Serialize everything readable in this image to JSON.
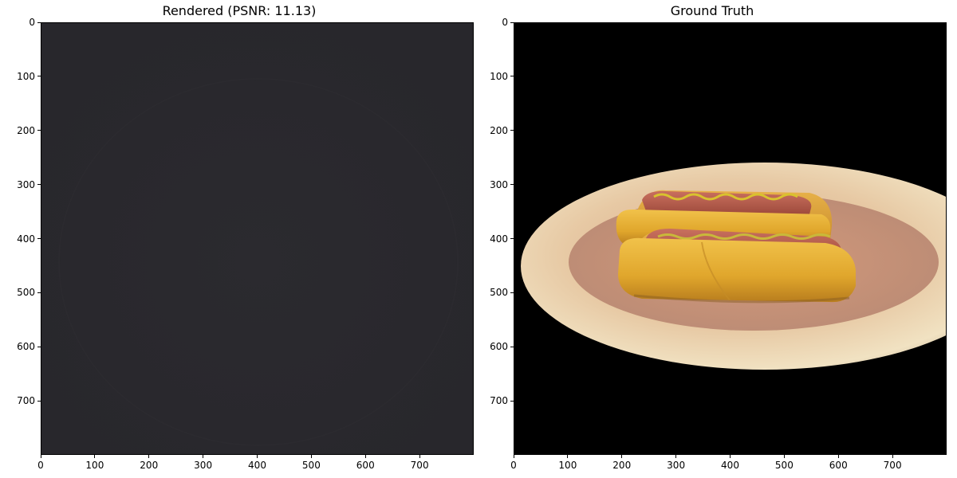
{
  "panels": [
    {
      "title": "Rendered (PSNR: 11.13)",
      "image": "dark-gray-render",
      "x_ticks": [
        "0",
        "100",
        "200",
        "300",
        "400",
        "500",
        "600",
        "700"
      ],
      "y_ticks": [
        "0",
        "100",
        "200",
        "300",
        "400",
        "500",
        "600",
        "700"
      ]
    },
    {
      "title": "Ground Truth",
      "image": "hotdogs-on-plate",
      "x_ticks": [
        "0",
        "100",
        "200",
        "300",
        "400",
        "500",
        "600",
        "700"
      ],
      "y_ticks": [
        "0",
        "100",
        "200",
        "300",
        "400",
        "500",
        "600",
        "700"
      ]
    }
  ],
  "colors": {
    "render_bg": "#2a292e",
    "truth_bg": "#000000",
    "bun": "#e0a62c",
    "sausage": "#b8584a",
    "mustard": "#d9c22e",
    "plate": "#e8d6b3"
  }
}
